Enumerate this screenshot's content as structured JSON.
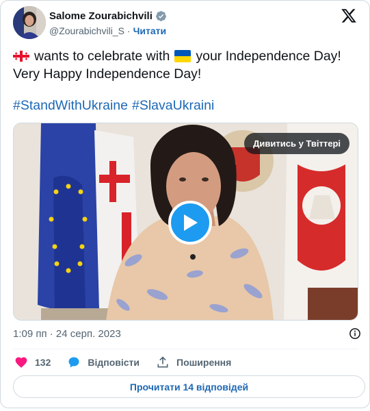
{
  "header": {
    "author_name": "Salome Zourabichvili",
    "handle": "@Zourabichvili_S",
    "separator": "·",
    "follow_label": "Читати",
    "verified_icon": "verified-badge-icon",
    "platform_icon": "x-logo-icon"
  },
  "tweet": {
    "line1_flag_before": "georgia-flag",
    "line1_text_a": "wants to celebrate with",
    "line1_flag_mid": "ukraine-flag",
    "line1_text_b": "your Independence Day!",
    "line2_text": "Very Happy Independence Day!",
    "hashtags": [
      "#StandWithUkraine",
      "#SlavaUkraini"
    ]
  },
  "media": {
    "watch_label": "Дивитись у Твіттері",
    "play_icon": "play-icon"
  },
  "meta": {
    "timestamp": "1:09 пп · 24 серп. 2023",
    "info_icon": "info-icon"
  },
  "actions": {
    "like_count": "132",
    "reply_label": "Відповісти",
    "share_label": "Поширення"
  },
  "footer": {
    "read_replies_label": "Прочитати 14 відповідей"
  },
  "colors": {
    "accent": "#1d9bf0",
    "link": "#1d68b5",
    "like": "#f91880",
    "text": "#0f1419",
    "muted": "#536471"
  }
}
